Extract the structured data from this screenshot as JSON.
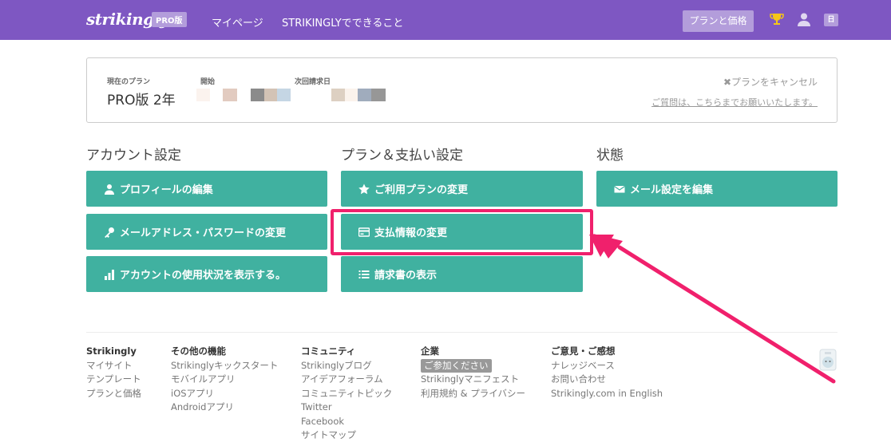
{
  "header": {
    "logo": "strikingly",
    "badge": "PRO版",
    "nav": [
      "マイページ",
      "STRIKINGLYでできること"
    ],
    "plan_button": "プランと価格",
    "lang": "日",
    "bg_color": "#7e57c2"
  },
  "plan": {
    "current_label": "現在のプラン",
    "current_value": "PRO版 2年",
    "start_label": "開始",
    "next_billing_label": "次回請求日",
    "cancel": "✖プランをキャンセル",
    "question": "ご質問は、こちらまでお願いいたします。"
  },
  "sections": {
    "account": {
      "title": "アカウント設定",
      "buttons": [
        {
          "label": "プロフィールの編集",
          "icon": "user-icon"
        },
        {
          "label": "メールアドレス・パスワードの変更",
          "icon": "key-icon"
        },
        {
          "label": "アカウントの使用状況を表示する。",
          "icon": "bar-chart-icon"
        }
      ]
    },
    "billing": {
      "title": "プラン＆支払い設定",
      "buttons": [
        {
          "label": "ご利用プランの変更",
          "icon": "star-icon"
        },
        {
          "label": "支払情報の変更",
          "icon": "credit-card-icon"
        },
        {
          "label": "請求書の表示",
          "icon": "list-icon"
        }
      ]
    },
    "status": {
      "title": "状態",
      "buttons": [
        {
          "label": "メール設定を編集",
          "icon": "envelope-icon"
        }
      ]
    },
    "button_color": "#40b1a0",
    "highlight_color": "#f0206c"
  },
  "footer": {
    "cols": [
      {
        "head": "Strikingly",
        "items": [
          "マイサイト",
          "テンプレート",
          "プランと価格"
        ]
      },
      {
        "head": "その他の機能",
        "items": [
          "Strikinglyキックスタート",
          "モバイルアプリ",
          "iOSアプリ",
          "Androidアプリ"
        ]
      },
      {
        "head": "コミュニティ",
        "items": [
          "Strikinglyブログ",
          "アイデアフォーラム",
          "コミュニティトピック",
          "Twitter",
          "Facebook",
          "サイトマップ"
        ]
      },
      {
        "head": "企業",
        "tag": "ご参加ください",
        "items": [
          "Strikinglyマニフェスト",
          "利用規約 & プライバシー"
        ]
      },
      {
        "head": "ご意見・ご感想",
        "items": [
          "ナレッジベース",
          "お問い合わせ",
          "Strikingly.com in English"
        ]
      }
    ]
  }
}
